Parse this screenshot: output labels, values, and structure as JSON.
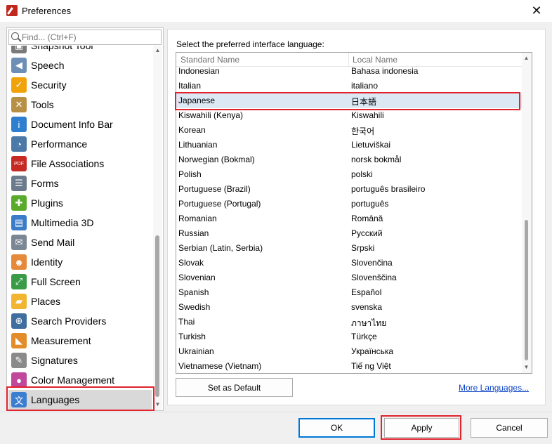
{
  "window": {
    "title": "Preferences",
    "close_glyph": "✕"
  },
  "search": {
    "placeholder": "Find... (Ctrl+F)"
  },
  "sidebar": {
    "items": [
      {
        "label": "Snapshot Tool",
        "icon": "snapshot-icon",
        "glyph": "▣",
        "color": "#7a7a7a"
      },
      {
        "label": "Speech",
        "icon": "speaker-icon",
        "glyph": "◀",
        "color": "#6d8fb5"
      },
      {
        "label": "Security",
        "icon": "shield-icon",
        "glyph": "✓",
        "color": "#f0a30a"
      },
      {
        "label": "Tools",
        "icon": "tools-icon",
        "glyph": "✕",
        "color": "#b89045"
      },
      {
        "label": "Document Info Bar",
        "icon": "info-icon",
        "glyph": "i",
        "color": "#2f7fd0"
      },
      {
        "label": "Performance",
        "icon": "gauge-icon",
        "glyph": "◔",
        "color": "#4b7aa8"
      },
      {
        "label": "File Associations",
        "icon": "pdf-icon",
        "glyph": "PDF",
        "color": "#c62a22"
      },
      {
        "label": "Forms",
        "icon": "form-icon",
        "glyph": "☰",
        "color": "#6c7b8c"
      },
      {
        "label": "Plugins",
        "icon": "puzzle-icon",
        "glyph": "✚",
        "color": "#5aaa2c"
      },
      {
        "label": "Multimedia 3D",
        "icon": "film-icon",
        "glyph": "▤",
        "color": "#3b7cc9"
      },
      {
        "label": "Send Mail",
        "icon": "mail-icon",
        "glyph": "✉",
        "color": "#7b8794"
      },
      {
        "label": "Identity",
        "icon": "user-icon",
        "glyph": "☻",
        "color": "#e58a3a"
      },
      {
        "label": "Full Screen",
        "icon": "fullscreen-icon",
        "glyph": "⤢",
        "color": "#3a9b46"
      },
      {
        "label": "Places",
        "icon": "folder-icon",
        "glyph": "▰",
        "color": "#f1b531"
      },
      {
        "label": "Search Providers",
        "icon": "globe-icon",
        "glyph": "⊕",
        "color": "#3d6e9e"
      },
      {
        "label": "Measurement",
        "icon": "ruler-icon",
        "glyph": "◣",
        "color": "#e28c2a"
      },
      {
        "label": "Signatures",
        "icon": "signature-icon",
        "glyph": "✎",
        "color": "#8a8a8a"
      },
      {
        "label": "Color Management",
        "icon": "color-wheel-icon",
        "glyph": "●",
        "color": "#c1479b"
      },
      {
        "label": "Languages",
        "icon": "languages-icon",
        "glyph": "文",
        "color": "#3b7ed0"
      }
    ]
  },
  "languages": {
    "prompt": "Select the preferred interface language:",
    "columns": [
      "Standard Name",
      "Local Name"
    ],
    "selected_index": 2,
    "rows": [
      [
        "Indonesian",
        "Bahasa indonesia"
      ],
      [
        "Italian",
        "italiano"
      ],
      [
        "Japanese",
        "日本語"
      ],
      [
        "Kiswahili (Kenya)",
        "Kiswahili"
      ],
      [
        "Korean",
        "한국어"
      ],
      [
        "Lithuanian",
        "Lietuviškai"
      ],
      [
        "Norwegian (Bokmal)",
        "norsk bokmål"
      ],
      [
        "Polish",
        "polski"
      ],
      [
        "Portuguese (Brazil)",
        "português brasileiro"
      ],
      [
        "Portuguese (Portugal)",
        "português"
      ],
      [
        "Romanian",
        "Română"
      ],
      [
        "Russian",
        "Русский"
      ],
      [
        "Serbian (Latin, Serbia)",
        "Srpski"
      ],
      [
        "Slovak",
        "Slovenčina"
      ],
      [
        "Slovenian",
        "Slovenščina"
      ],
      [
        "Spanish",
        "Español"
      ],
      [
        "Swedish",
        "svenska"
      ],
      [
        "Thai",
        "ภาษาไทย"
      ],
      [
        "Turkish",
        "Türkçe"
      ],
      [
        "Ukrainian",
        "Українська"
      ],
      [
        "Vietnamese (Vietnam)",
        "Tiế ng Việt"
      ]
    ],
    "set_default_label": "Set as Default",
    "more_languages_label": "More Languages..."
  },
  "footer": {
    "ok_label": "OK",
    "apply_label": "Apply",
    "cancel_label": "Cancel"
  },
  "colors": {
    "highlight": "#e1232e",
    "selection": "#dce9f5",
    "link": "#0b43c7"
  }
}
